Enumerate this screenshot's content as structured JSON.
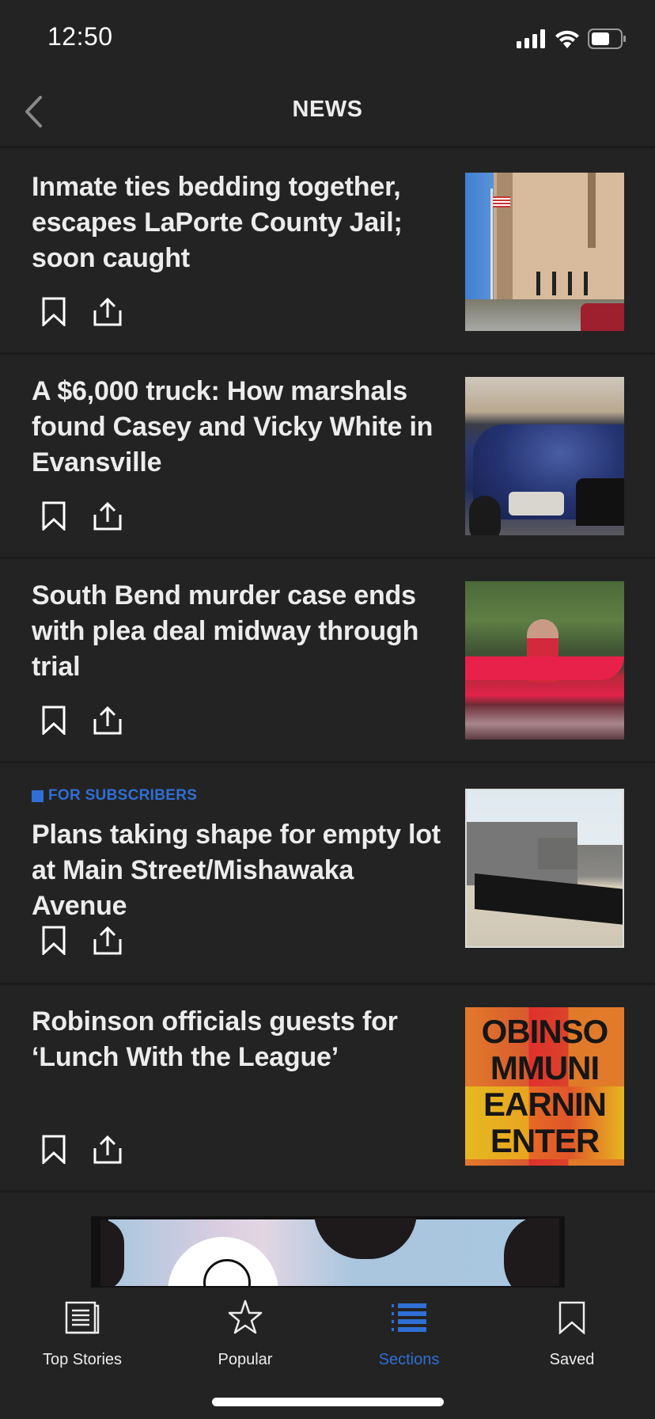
{
  "status_bar": {
    "time": "12:50",
    "icons": [
      "cellular-signal-icon",
      "wifi-icon",
      "battery-icon"
    ]
  },
  "nav": {
    "title": "NEWS",
    "back_icon": "chevron-left-icon"
  },
  "articles": [
    {
      "title": "Inmate ties bedding together, escapes LaPorte County Jail; soon caught",
      "label": null,
      "thumbnail": "jail building with flag"
    },
    {
      "title": "A $6,000 truck: How marshals found Casey and Vicky White in Evansville",
      "label": null,
      "thumbnail": "blue pickup truck"
    },
    {
      "title": "South Bend murder case ends with plea deal midway through trial",
      "label": null,
      "thumbnail": "woman in red kayak"
    },
    {
      "title": "Plans taking shape for empty lot at Main Street/Mishawaka Avenue",
      "label": "FOR SUBSCRIBERS",
      "thumbnail": "empty lot with black fence"
    },
    {
      "title": "Robinson officials guests for ‘Lunch With the League’",
      "label": null,
      "thumbnail": "Robinson Community Learning Center sign",
      "thumbnail_text": [
        "OBINSO",
        "MMUNI",
        "EARNIN",
        "ENTER"
      ]
    }
  ],
  "article_actions": {
    "bookmark_icon": "bookmark-icon",
    "share_icon": "share-icon"
  },
  "tabs": [
    {
      "label": "Top Stories",
      "icon": "newspaper-icon",
      "active": false
    },
    {
      "label": "Popular",
      "icon": "star-icon",
      "active": false
    },
    {
      "label": "Sections",
      "icon": "list-icon",
      "active": true
    },
    {
      "label": "Saved",
      "icon": "bookmark-icon",
      "active": false
    }
  ],
  "colors": {
    "background": "#232323",
    "divider": "#1c1c1c",
    "text": "#ececec",
    "accent": "#2f6fd6"
  }
}
